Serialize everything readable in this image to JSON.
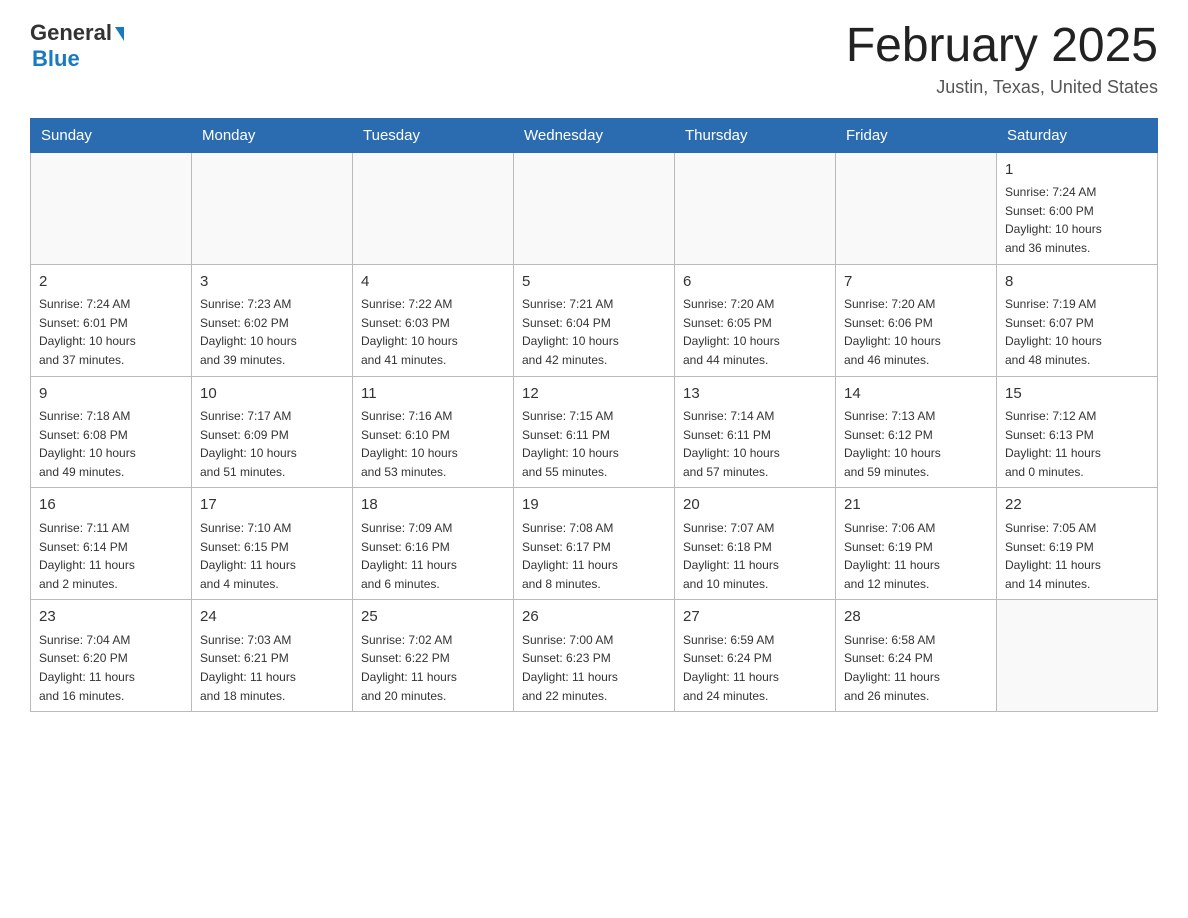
{
  "logo": {
    "general": "General",
    "blue": "Blue"
  },
  "header": {
    "title": "February 2025",
    "location": "Justin, Texas, United States"
  },
  "weekdays": [
    "Sunday",
    "Monday",
    "Tuesday",
    "Wednesday",
    "Thursday",
    "Friday",
    "Saturday"
  ],
  "weeks": [
    [
      {
        "day": "",
        "info": ""
      },
      {
        "day": "",
        "info": ""
      },
      {
        "day": "",
        "info": ""
      },
      {
        "day": "",
        "info": ""
      },
      {
        "day": "",
        "info": ""
      },
      {
        "day": "",
        "info": ""
      },
      {
        "day": "1",
        "info": "Sunrise: 7:24 AM\nSunset: 6:00 PM\nDaylight: 10 hours\nand 36 minutes."
      }
    ],
    [
      {
        "day": "2",
        "info": "Sunrise: 7:24 AM\nSunset: 6:01 PM\nDaylight: 10 hours\nand 37 minutes."
      },
      {
        "day": "3",
        "info": "Sunrise: 7:23 AM\nSunset: 6:02 PM\nDaylight: 10 hours\nand 39 minutes."
      },
      {
        "day": "4",
        "info": "Sunrise: 7:22 AM\nSunset: 6:03 PM\nDaylight: 10 hours\nand 41 minutes."
      },
      {
        "day": "5",
        "info": "Sunrise: 7:21 AM\nSunset: 6:04 PM\nDaylight: 10 hours\nand 42 minutes."
      },
      {
        "day": "6",
        "info": "Sunrise: 7:20 AM\nSunset: 6:05 PM\nDaylight: 10 hours\nand 44 minutes."
      },
      {
        "day": "7",
        "info": "Sunrise: 7:20 AM\nSunset: 6:06 PM\nDaylight: 10 hours\nand 46 minutes."
      },
      {
        "day": "8",
        "info": "Sunrise: 7:19 AM\nSunset: 6:07 PM\nDaylight: 10 hours\nand 48 minutes."
      }
    ],
    [
      {
        "day": "9",
        "info": "Sunrise: 7:18 AM\nSunset: 6:08 PM\nDaylight: 10 hours\nand 49 minutes."
      },
      {
        "day": "10",
        "info": "Sunrise: 7:17 AM\nSunset: 6:09 PM\nDaylight: 10 hours\nand 51 minutes."
      },
      {
        "day": "11",
        "info": "Sunrise: 7:16 AM\nSunset: 6:10 PM\nDaylight: 10 hours\nand 53 minutes."
      },
      {
        "day": "12",
        "info": "Sunrise: 7:15 AM\nSunset: 6:11 PM\nDaylight: 10 hours\nand 55 minutes."
      },
      {
        "day": "13",
        "info": "Sunrise: 7:14 AM\nSunset: 6:11 PM\nDaylight: 10 hours\nand 57 minutes."
      },
      {
        "day": "14",
        "info": "Sunrise: 7:13 AM\nSunset: 6:12 PM\nDaylight: 10 hours\nand 59 minutes."
      },
      {
        "day": "15",
        "info": "Sunrise: 7:12 AM\nSunset: 6:13 PM\nDaylight: 11 hours\nand 0 minutes."
      }
    ],
    [
      {
        "day": "16",
        "info": "Sunrise: 7:11 AM\nSunset: 6:14 PM\nDaylight: 11 hours\nand 2 minutes."
      },
      {
        "day": "17",
        "info": "Sunrise: 7:10 AM\nSunset: 6:15 PM\nDaylight: 11 hours\nand 4 minutes."
      },
      {
        "day": "18",
        "info": "Sunrise: 7:09 AM\nSunset: 6:16 PM\nDaylight: 11 hours\nand 6 minutes."
      },
      {
        "day": "19",
        "info": "Sunrise: 7:08 AM\nSunset: 6:17 PM\nDaylight: 11 hours\nand 8 minutes."
      },
      {
        "day": "20",
        "info": "Sunrise: 7:07 AM\nSunset: 6:18 PM\nDaylight: 11 hours\nand 10 minutes."
      },
      {
        "day": "21",
        "info": "Sunrise: 7:06 AM\nSunset: 6:19 PM\nDaylight: 11 hours\nand 12 minutes."
      },
      {
        "day": "22",
        "info": "Sunrise: 7:05 AM\nSunset: 6:19 PM\nDaylight: 11 hours\nand 14 minutes."
      }
    ],
    [
      {
        "day": "23",
        "info": "Sunrise: 7:04 AM\nSunset: 6:20 PM\nDaylight: 11 hours\nand 16 minutes."
      },
      {
        "day": "24",
        "info": "Sunrise: 7:03 AM\nSunset: 6:21 PM\nDaylight: 11 hours\nand 18 minutes."
      },
      {
        "day": "25",
        "info": "Sunrise: 7:02 AM\nSunset: 6:22 PM\nDaylight: 11 hours\nand 20 minutes."
      },
      {
        "day": "26",
        "info": "Sunrise: 7:00 AM\nSunset: 6:23 PM\nDaylight: 11 hours\nand 22 minutes."
      },
      {
        "day": "27",
        "info": "Sunrise: 6:59 AM\nSunset: 6:24 PM\nDaylight: 11 hours\nand 24 minutes."
      },
      {
        "day": "28",
        "info": "Sunrise: 6:58 AM\nSunset: 6:24 PM\nDaylight: 11 hours\nand 26 minutes."
      },
      {
        "day": "",
        "info": ""
      }
    ]
  ]
}
